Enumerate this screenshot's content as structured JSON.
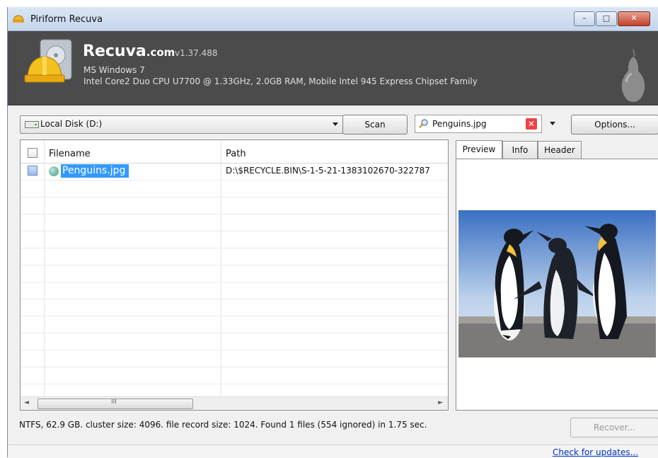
{
  "window": {
    "title": "Piriform Recuva",
    "minimize_label": "–",
    "maximize_label": "□",
    "close_label": "✕"
  },
  "header": {
    "brand": "Recuva",
    "brand_domain": ".com",
    "version": "v1.37.488",
    "os": "MS Windows 7",
    "system": "Intel Core2 Duo CPU U7700 @ 1.33GHz, 2.0GB RAM, Mobile Intel 945 Express Chipset Family"
  },
  "toolbar": {
    "drive": "Local Disk (D:)",
    "scan_label": "Scan",
    "search_value": "Penguins.jpg",
    "clear_label": "✕",
    "options_label": "Options..."
  },
  "list": {
    "columns": [
      "Filename",
      "Path"
    ],
    "rows": [
      {
        "filename": "Penguins.jpg",
        "path": "D:\\$RECYCLE.BIN\\S-1-5-21-1383102670-322787"
      }
    ],
    "scroll_grip": "III"
  },
  "tabs": [
    "Preview",
    "Info",
    "Header"
  ],
  "status": "NTFS, 62.9 GB. cluster size: 4096. file record size: 1024. Found 1 files (554 ignored) in 1.75 sec.",
  "recover_label": "Recover...",
  "updates_link": "Check for updates..."
}
